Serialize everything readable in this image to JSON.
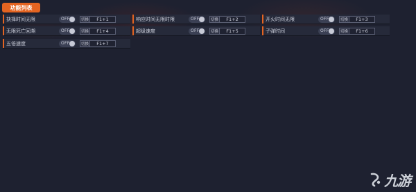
{
  "header": {
    "title": "功能列表"
  },
  "rows": [
    {
      "label": "抉择时间无限",
      "toggle": "OFF",
      "switch": "切换",
      "hotkey": "F1+1"
    },
    {
      "label": "响应时间无限时限",
      "toggle": "OFF",
      "switch": "切换",
      "hotkey": "F1+2"
    },
    {
      "label": "开火时间无限",
      "toggle": "OFF",
      "switch": "切换",
      "hotkey": "F1+3"
    },
    {
      "label": "无限死亡回溯",
      "toggle": "OFF",
      "switch": "切换",
      "hotkey": "F1+4"
    },
    {
      "label": "超级速度",
      "toggle": "OFF",
      "switch": "切换",
      "hotkey": "F1+5"
    },
    {
      "label": "子弹时间",
      "toggle": "OFF",
      "switch": "切换",
      "hotkey": "F1+6"
    },
    {
      "label": "五倍速度",
      "toggle": "OFF",
      "switch": "切换",
      "hotkey": "F1+7"
    }
  ],
  "watermark": {
    "text": "九游",
    "icon": "jiuyou-logo-icon"
  },
  "colors": {
    "accent": "#e46421",
    "background": "#1e2130",
    "row": "#262a3a"
  }
}
